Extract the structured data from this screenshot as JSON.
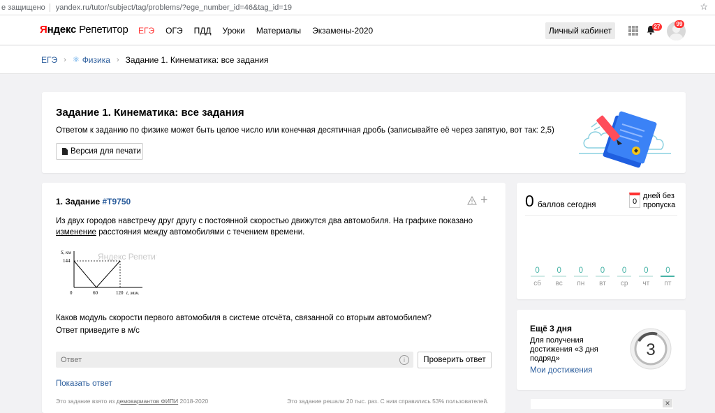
{
  "browser": {
    "secure_label": "е защищено",
    "url": "yandex.ru/tutor/subject/tag/problems/?ege_number_id=46&tag_id=19"
  },
  "header": {
    "logo_ya_1": "Я",
    "logo_ya_2": "ндекс",
    "logo_rep": "Репетитор",
    "nav": [
      "ЕГЭ",
      "ОГЭ",
      "ПДД",
      "Уроки",
      "Материалы",
      "Экзамены-2020"
    ],
    "account_button": "Личный кабинет",
    "notifications_count": "27",
    "avatar_count": "99"
  },
  "breadcrumbs": {
    "root": "ЕГЭ",
    "subject": "Физика",
    "current": "Задание 1. Кинематика: все задания"
  },
  "intro": {
    "title": "Задание 1. Кинематика: все задания",
    "description": "Ответом к заданию по физике может быть целое число или конечная десятичная дробь (записывайте её через запятую, вот так: 2,5)",
    "print_button": "Версия для печати"
  },
  "problem": {
    "number_label": "1. Задание",
    "id": "#T9750",
    "text_before": "Из двух городов навстречу друг другу с постоянной скоростью движутся два автомобиля. На графике показано",
    "text_underlined": "изменение",
    "text_after": " расстояния между автомобилями с течением времени.",
    "graph": {
      "y_label": "S, км",
      "y_value": "144",
      "x_ticks": [
        "0",
        "60",
        "120"
      ],
      "x_label": "t, мин.",
      "watermark": "Яндекс Репетитор"
    },
    "question": "Каков модуль скорости первого автомобиля в системе отсчёта, связанной со вторым автомобилем?",
    "units_hint": "Ответ приведите в м/с",
    "answer_placeholder": "Ответ",
    "info_glyph": "i",
    "check_button": "Проверить ответ",
    "show_answer": "Показать ответ",
    "source_prefix": "Это задание взято из ",
    "source_link": "демовариантов ФИПИ",
    "source_years": " 2018-2020",
    "stats_text": "Это задание решали 20 тыс. раз. С ним справились 53% пользователей."
  },
  "stats": {
    "points": "0",
    "points_label": "баллов сегодня",
    "streak_value": "0",
    "streak_label_1": "дней без",
    "streak_label_2": "пропуска",
    "days": [
      {
        "value": "0",
        "label": "сб"
      },
      {
        "value": "0",
        "label": "вс"
      },
      {
        "value": "0",
        "label": "пн"
      },
      {
        "value": "0",
        "label": "вт"
      },
      {
        "value": "0",
        "label": "ср"
      },
      {
        "value": "0",
        "label": "чт"
      },
      {
        "value": "0",
        "label": "пт"
      }
    ]
  },
  "achievement": {
    "title": "Ещё 3 дня",
    "description": "Для получения достижения «3 дня подряд»",
    "link": "Мои достижения",
    "medal_number": "3"
  },
  "ad": {
    "close_glyph": "✕"
  },
  "colors": {
    "accent_red": "#ff3333",
    "link_blue": "#2b5d9c",
    "teal": "#47b3a6"
  }
}
